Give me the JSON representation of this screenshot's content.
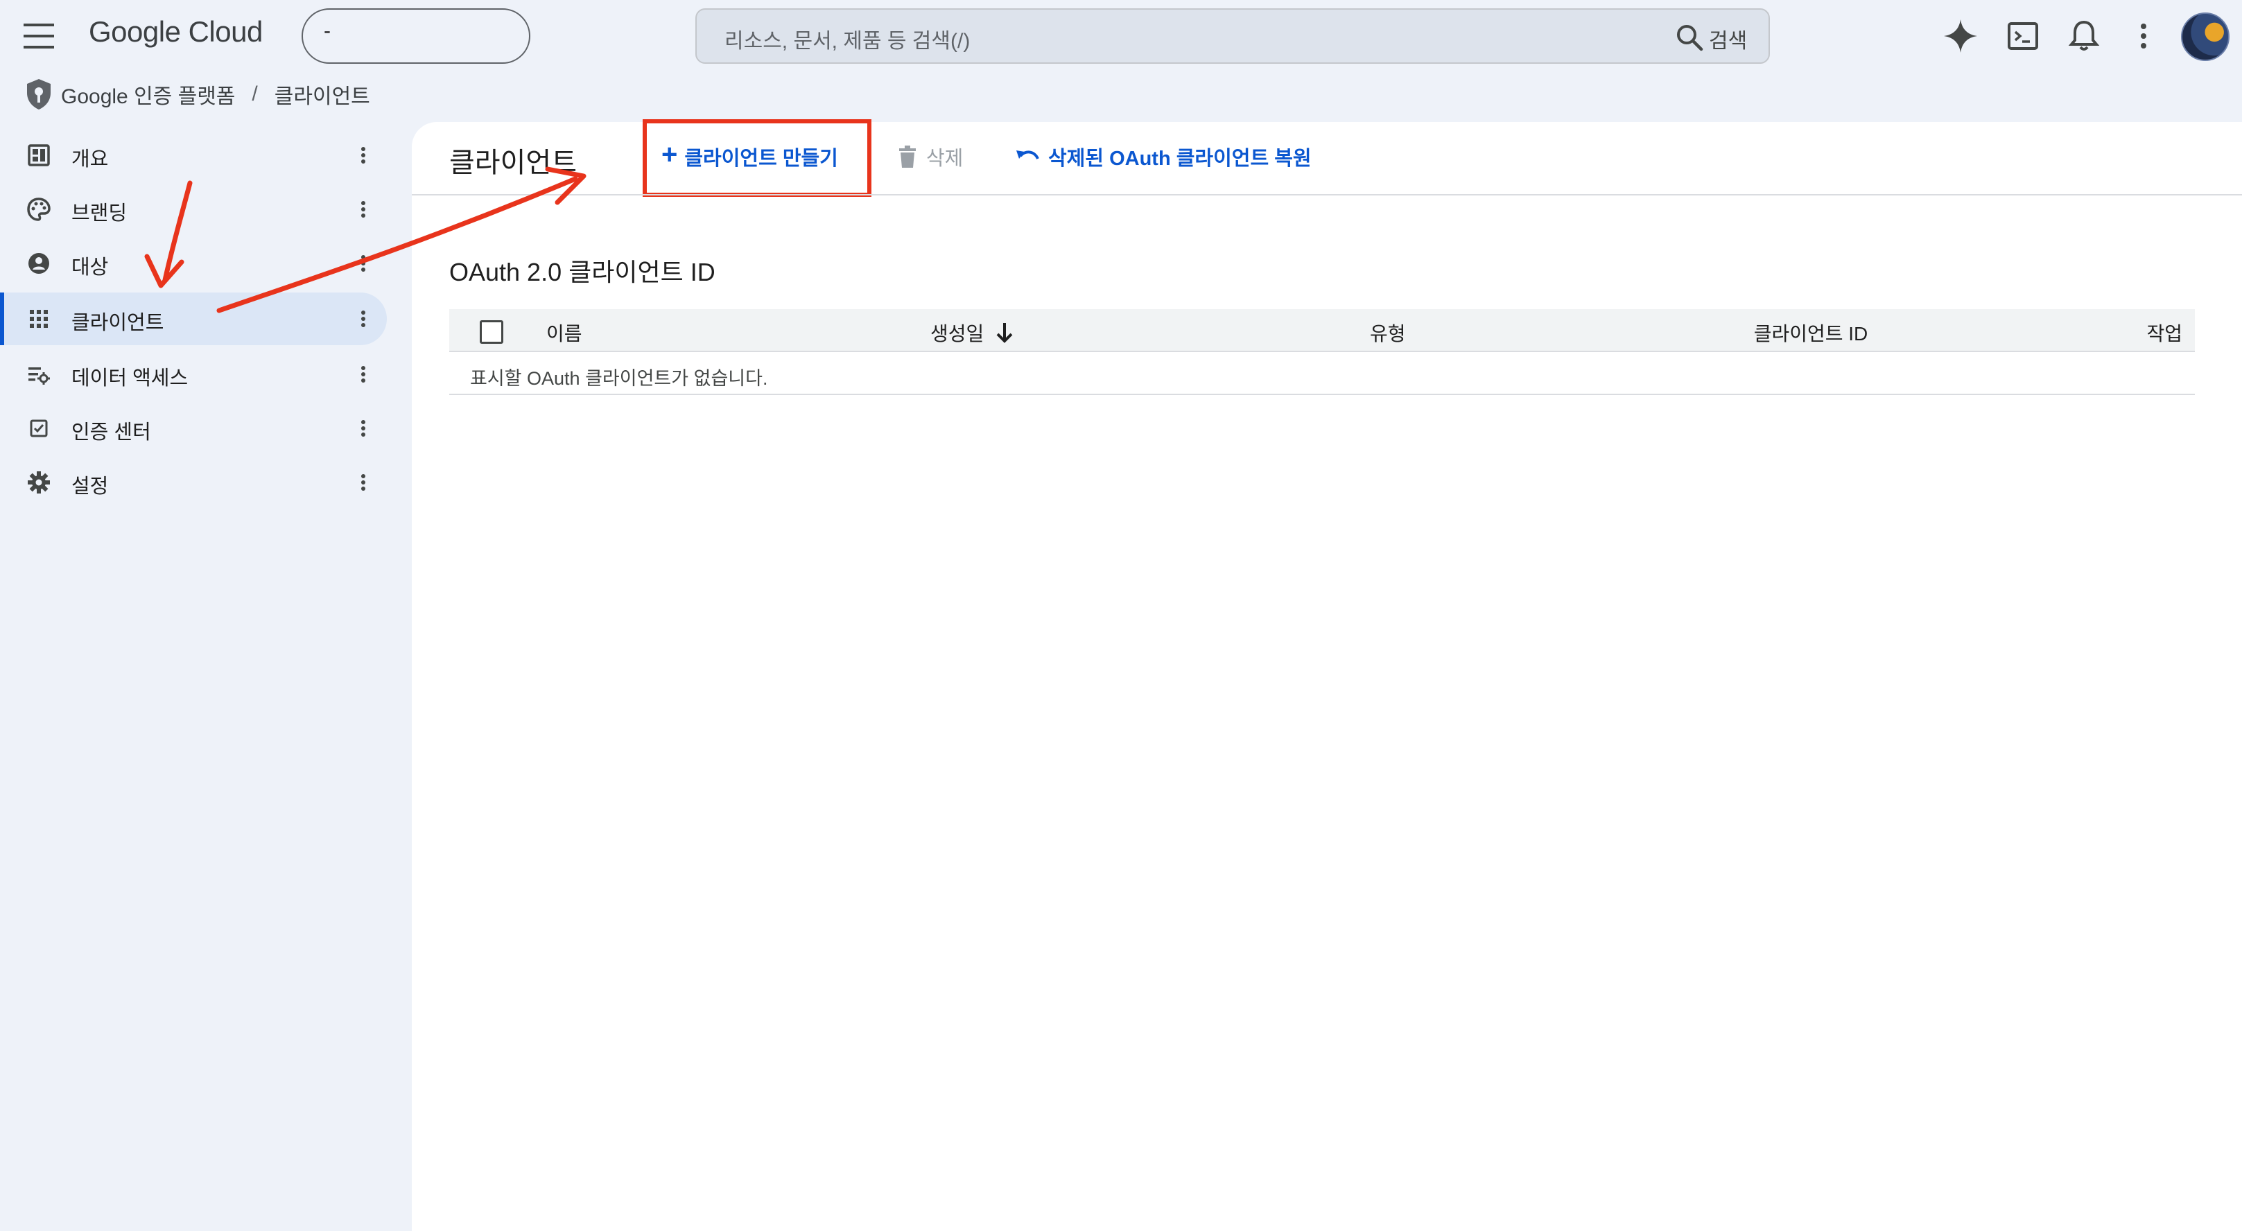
{
  "app": {
    "logo": "Google Cloud",
    "project_picker": "-"
  },
  "search": {
    "placeholder": "리소스, 문서, 제품 등 검색(/)",
    "button_label": "검색"
  },
  "top_icons": [
    "gemini-icon",
    "cloud-shell-icon",
    "bell-icon",
    "more-vert-icon"
  ],
  "breadcrumb": {
    "product": "Google 인증 플랫폼",
    "separator": "/",
    "current": "클라이언트"
  },
  "sidebar": {
    "items": [
      {
        "label": "개요",
        "icon": "dashboard-icon",
        "active": false
      },
      {
        "label": "브랜딩",
        "icon": "palette-icon",
        "active": false
      },
      {
        "label": "대상",
        "icon": "account-circle-icon",
        "active": false
      },
      {
        "label": "클라이언트",
        "icon": "apps-grid-icon",
        "active": true
      },
      {
        "label": "데이터 액세스",
        "icon": "data-access-icon",
        "active": false
      },
      {
        "label": "인증 센터",
        "icon": "verified-checkbox-icon",
        "active": false
      },
      {
        "label": "설정",
        "icon": "gear-icon",
        "active": false
      }
    ]
  },
  "main": {
    "title": "클라이언트",
    "toolbar": {
      "create_label": "클라이언트 만들기",
      "delete_label": "삭제",
      "restore_label": "삭제된 OAuth 클라이언트 복원"
    },
    "section_title": "OAuth 2.0 클라이언트 ID",
    "table": {
      "columns": [
        "이름",
        "생성일",
        "유형",
        "클라이언트 ID",
        "작업"
      ],
      "sort_column": "생성일",
      "sort_direction": "descending",
      "rows": [],
      "empty_message": "표시할 OAuth 클라이언트가 없습니다."
    }
  },
  "colors": {
    "accent": "#0b57d0",
    "annotation": "#e8341c",
    "active_nav_bg": "#dbe6f6",
    "page_bg": "#eef2f9"
  }
}
